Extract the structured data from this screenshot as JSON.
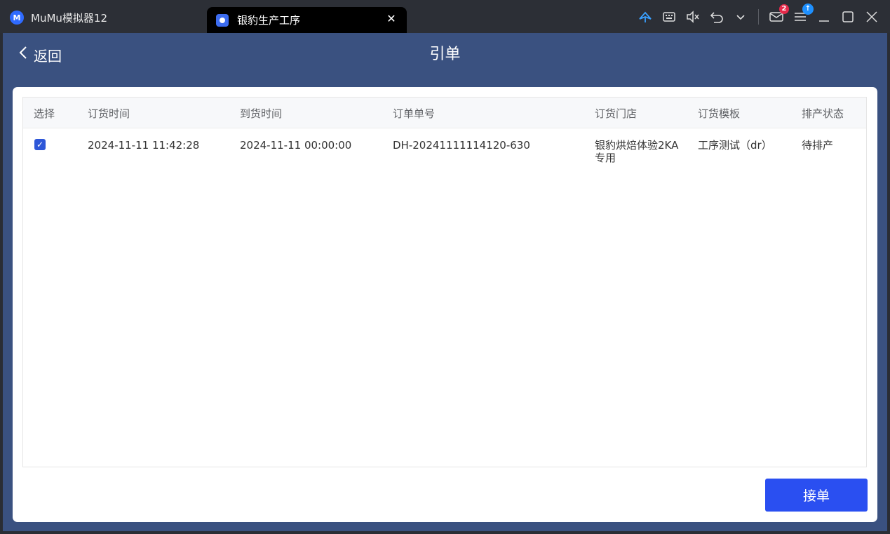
{
  "window": {
    "app_tab_title": "MuMu模拟器12",
    "app_logo_glyph": "M",
    "active_tab_title": "银豹生产工序",
    "close_glyph": "✕",
    "icons": {
      "feather": "feather-icon",
      "keyboard": "keyboard-icon",
      "volume_muted": "volume-muted-icon",
      "undo": "undo-icon",
      "chevron": "chevron-down-icon",
      "mail": "mail-icon",
      "menu": "menu-icon",
      "minimize": "minimize-icon",
      "maximize": "maximize-icon",
      "close": "close-icon"
    },
    "mail_badge": "2",
    "update_badge": "↑",
    "colors": {
      "mail_badge": "#e5294a",
      "update_badge": "#1e90ff"
    }
  },
  "appbar": {
    "back_label": "返回",
    "title": "引单",
    "color": "#3a5180"
  },
  "table": {
    "headers": {
      "select": "选择",
      "order_time": "订货时间",
      "arrival_time": "到货时间",
      "order_no": "订单单号",
      "store": "订货门店",
      "template": "订货模板",
      "status": "排产状态"
    },
    "rows": [
      {
        "checked": true,
        "check_glyph": "✓",
        "order_time": "2024-11-11  11:42:28",
        "arrival_time": "2024-11-11  00:00:00",
        "order_no": "DH-20241111114120-630",
        "store_line1": "银豹烘焙体验2KA",
        "store_line2": "专用",
        "template": "工序测试（dr）",
        "status": "待排产"
      }
    ]
  },
  "actions": {
    "accept_label": "接单",
    "accept_color": "#2a4ff1"
  }
}
